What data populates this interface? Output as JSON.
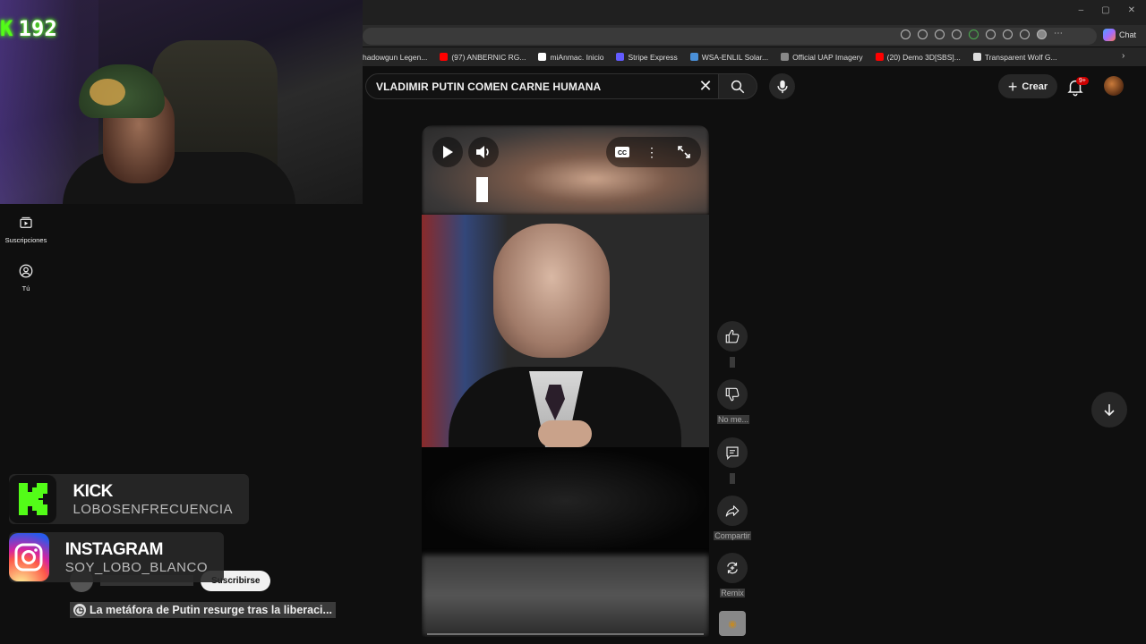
{
  "browser": {
    "bookmarks": [
      {
        "label": "hadowgun Legen...",
        "color": "#6a6a6a"
      },
      {
        "label": "(97) ANBERNIC RG...",
        "color": "#ff0000"
      },
      {
        "label": "miAnmac. Inicio",
        "color": "#ffffff"
      },
      {
        "label": "Stripe Express",
        "color": "#635bff"
      },
      {
        "label": "WSA-ENLIL Solar...",
        "color": "#4a90d9"
      },
      {
        "label": "Official UAP Imagery",
        "color": "#888888"
      },
      {
        "label": "(20) Demo 3D[SBS]...",
        "color": "#ff0000"
      },
      {
        "label": "Transparent Wolf G...",
        "color": "#dddddd"
      }
    ],
    "chat_label": "Chat",
    "window_controls": [
      "–",
      "▢",
      "✕"
    ]
  },
  "youtube": {
    "search_query": "VLADIMIR PUTIN COMEN CARNE HUMANA",
    "create_label": "Crear",
    "notif_badge": "9+",
    "nav": [
      {
        "label": "Suscripciones",
        "icon": "subscriptions-icon"
      },
      {
        "label": "Tú",
        "icon": "you-icon"
      }
    ],
    "actions": {
      "like_count": "",
      "dislike_label": "No me...",
      "comments_count": "",
      "share_label": "Compartir",
      "remix_label": "Remix"
    },
    "subscribe_label": "Suscribirse",
    "video_title": "La metáfora de Putin resurge tras la liberaci..."
  },
  "overlay": {
    "kick_counter": "192",
    "kick_title": "KICK",
    "kick_handle": "LOBOSENFRECUENCIA",
    "ig_title": "INSTAGRAM",
    "ig_handle": "SOY_LOBO_BLANCO"
  },
  "colors": {
    "kick_green": "#53fc18",
    "yt_red": "#cc0000",
    "bg": "#0f0f0f"
  }
}
